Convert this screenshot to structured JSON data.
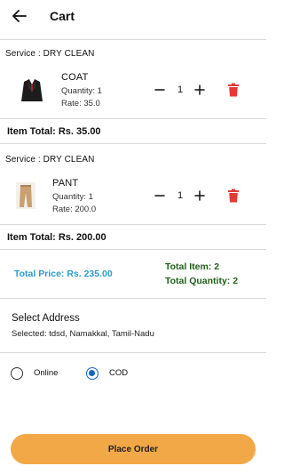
{
  "header": {
    "title": "Cart"
  },
  "items": [
    {
      "service": "Service : DRY CLEAN",
      "name": "COAT",
      "quantity": "Quantity: 1",
      "rate": "Rate: 35.0",
      "qty": "1",
      "total": "Item Total: Rs. 35.00",
      "image": "coat-image"
    },
    {
      "service": "Service : DRY CLEAN",
      "name": "PANT",
      "quantity": "Quantity: 1",
      "rate": "Rate: 200.0",
      "qty": "1",
      "total": "Item Total: Rs. 200.00",
      "image": "pant-image"
    }
  ],
  "summary": {
    "total_price": "Total Price: Rs. 235.00",
    "total_item": "Total Item: 2",
    "total_quantity": "Total Quantity: 2"
  },
  "address": {
    "title": "Select Address",
    "selected": "Selected: tdsd, Namakkal, Tamil-Nadu"
  },
  "payment": {
    "options": [
      "Online",
      "COD"
    ],
    "selected": "COD"
  },
  "actions": {
    "place_order": "Place Order"
  },
  "colors": {
    "accent_button": "#f2a847",
    "price_blue": "#2a9bd1",
    "summary_green": "#1f5f1a",
    "delete_red": "#e53935",
    "radio_blue": "#1565c0"
  },
  "icons": {
    "back": "arrow-left-icon",
    "minus": "minus-icon",
    "plus": "plus-icon",
    "delete": "trash-icon"
  }
}
